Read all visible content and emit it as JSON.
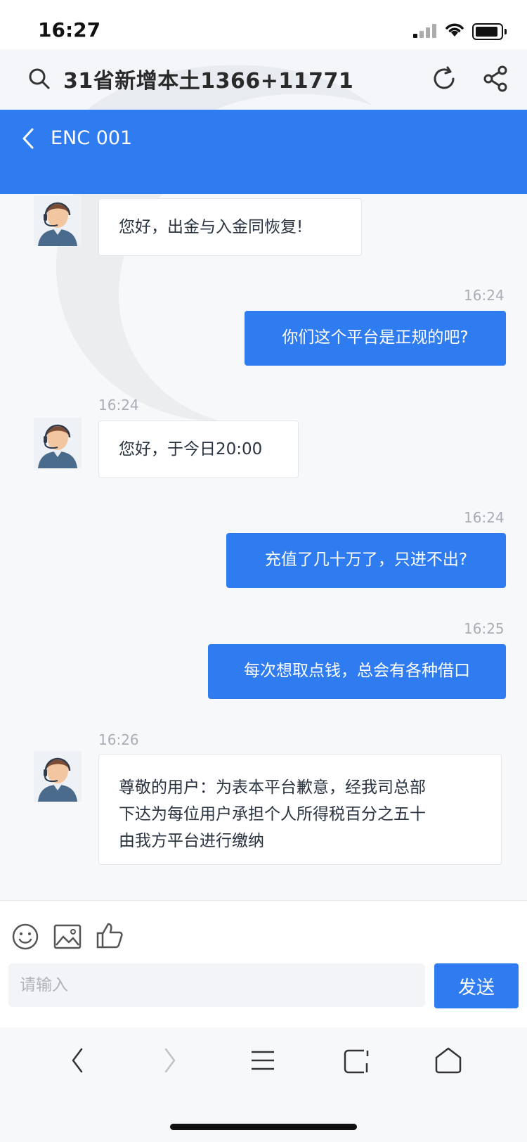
{
  "status_bar": {
    "time": "16:27"
  },
  "browser": {
    "search_query": "31省新增本土1366+11771"
  },
  "header": {
    "title": "ENC 001"
  },
  "messages": [
    {
      "side": "in",
      "time": "",
      "text": "您好，出金与入金同恢复!"
    },
    {
      "side": "out",
      "time": "16:24",
      "text": "你们这个平台是正规的吧?"
    },
    {
      "side": "in",
      "time": "16:24",
      "text": "您好，于今日20:00"
    },
    {
      "side": "out",
      "time": "16:24",
      "text": "充值了几十万了，只进不出?"
    },
    {
      "side": "out",
      "time": "16:25",
      "text": "每次想取点钱，总会有各种借口"
    },
    {
      "side": "in",
      "time": "16:26",
      "lines": [
        "尊敬的用户：为表本平台歉意，经我司总部",
        "下达为每位用户承担个人所得税百分之五十",
        "由我方平台进行缴纳"
      ]
    }
  ],
  "composer": {
    "placeholder": "请输入",
    "send_label": "发送"
  },
  "colors": {
    "accent": "#2f7bf0",
    "bubble_in_bg": "#ffffff",
    "page_bg": "#f7f8fa"
  },
  "icons": [
    "search-icon",
    "refresh-icon",
    "share-icon",
    "back-icon",
    "emoji-icon",
    "image-icon",
    "thumbs-up-icon",
    "nav-back-icon",
    "nav-forward-icon",
    "menu-icon",
    "tabs-icon",
    "home-icon"
  ]
}
